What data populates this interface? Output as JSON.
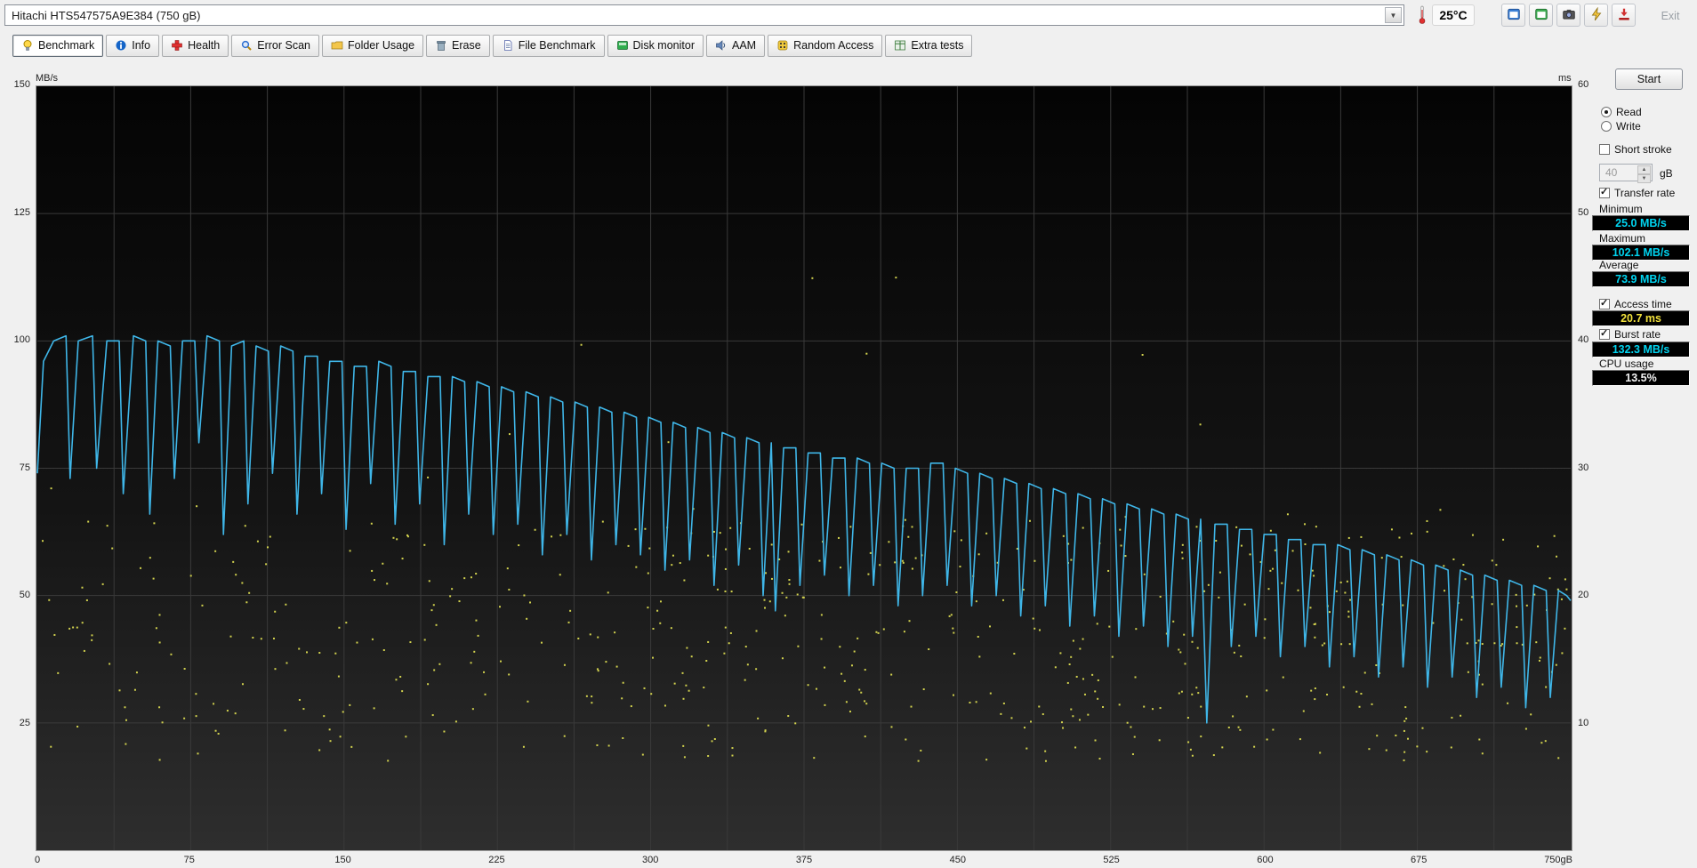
{
  "window": {
    "device_selector": "Hitachi HTS547575A9E384 (750 gB)",
    "temperature": "25°C",
    "exit_label": "Exit",
    "toolbar_buttons": [
      "window-copy-icon",
      "window-compare-icon",
      "camera-icon",
      "connect-icon",
      "download-icon"
    ]
  },
  "tabs": [
    {
      "label": "Benchmark",
      "icon": "benchmark-icon",
      "active": true
    },
    {
      "label": "Info",
      "icon": "info-icon",
      "active": false
    },
    {
      "label": "Health",
      "icon": "health-icon",
      "active": false
    },
    {
      "label": "Error Scan",
      "icon": "error-scan-icon",
      "active": false
    },
    {
      "label": "Folder Usage",
      "icon": "folder-usage-icon",
      "active": false
    },
    {
      "label": "Erase",
      "icon": "erase-icon",
      "active": false
    },
    {
      "label": "File Benchmark",
      "icon": "file-benchmark-icon",
      "active": false
    },
    {
      "label": "Disk monitor",
      "icon": "disk-monitor-icon",
      "active": false
    },
    {
      "label": "AAM",
      "icon": "aam-icon",
      "active": false
    },
    {
      "label": "Random Access",
      "icon": "random-access-icon",
      "active": false
    },
    {
      "label": "Extra tests",
      "icon": "extra-tests-icon",
      "active": false
    }
  ],
  "panel": {
    "start_button": "Start",
    "read_label": "Read",
    "read_selected": true,
    "write_label": "Write",
    "write_selected": false,
    "short_stroke_label": "Short stroke",
    "short_stroke_checked": false,
    "capacity_value": "40",
    "capacity_unit": "gB",
    "transfer_rate_label": "Transfer rate",
    "transfer_rate_checked": true,
    "minimum_label": "Minimum",
    "minimum_value": "25.0 MB/s",
    "maximum_label": "Maximum",
    "maximum_value": "102.1 MB/s",
    "average_label": "Average",
    "average_value": "73.9 MB/s",
    "access_time_label": "Access time",
    "access_time_checked": true,
    "access_time_value": "20.7 ms",
    "burst_rate_label": "Burst rate",
    "burst_rate_checked": true,
    "burst_rate_value": "132.3 MB/s",
    "cpu_usage_label": "CPU usage",
    "cpu_usage_value": "13.5%",
    "value_colors": {
      "rate": "#00d4f0",
      "access": "#f2e23c",
      "cpu": "#f2f2f2"
    }
  },
  "chart_data": {
    "type": "line+scatter",
    "left_axis": {
      "label": "MB/s",
      "min": 0,
      "max": 150,
      "ticks": [
        150,
        125,
        100,
        75,
        50,
        25
      ]
    },
    "right_axis": {
      "label": "ms",
      "min": 0,
      "max": 60,
      "ticks": [
        60,
        50,
        40,
        30,
        20,
        10
      ]
    },
    "x_axis": {
      "label": "gB",
      "min": 0,
      "max": 750,
      "ticks": [
        0,
        75,
        150,
        225,
        300,
        375,
        450,
        525,
        600,
        675
      ],
      "max_label": "750gB"
    },
    "grid": {
      "v_divisions": 20,
      "h_step": 25,
      "color": "#3a3a3a"
    },
    "plot_bg": [
      "#040404",
      "#2e2e2e"
    ],
    "series": [
      {
        "name": "Transfer rate",
        "type": "line",
        "axis": "left",
        "unit": "MB/s",
        "color": "#3fb6e8",
        "stats": {
          "minimum": 25.0,
          "maximum": 102.1,
          "average": 73.9
        },
        "points": [
          [
            0,
            74
          ],
          [
            3,
            96
          ],
          [
            8,
            100
          ],
          [
            14,
            101
          ],
          [
            16,
            73
          ],
          [
            20,
            100
          ],
          [
            27,
            101
          ],
          [
            29,
            75
          ],
          [
            34,
            100
          ],
          [
            40,
            100
          ],
          [
            42,
            70
          ],
          [
            47,
            101
          ],
          [
            53,
            100
          ],
          [
            55,
            66
          ],
          [
            59,
            100
          ],
          [
            65,
            99
          ],
          [
            67,
            73
          ],
          [
            71,
            100
          ],
          [
            77,
            100
          ],
          [
            79,
            80
          ],
          [
            83,
            101
          ],
          [
            89,
            100
          ],
          [
            91,
            62
          ],
          [
            95,
            99
          ],
          [
            101,
            100
          ],
          [
            103,
            68
          ],
          [
            107,
            99
          ],
          [
            113,
            98
          ],
          [
            115,
            74
          ],
          [
            119,
            99
          ],
          [
            125,
            98
          ],
          [
            127,
            66
          ],
          [
            131,
            97
          ],
          [
            137,
            97
          ],
          [
            139,
            70
          ],
          [
            143,
            96
          ],
          [
            149,
            96
          ],
          [
            151,
            63
          ],
          [
            155,
            95
          ],
          [
            161,
            95
          ],
          [
            163,
            72
          ],
          [
            167,
            96
          ],
          [
            173,
            95
          ],
          [
            175,
            64
          ],
          [
            179,
            94
          ],
          [
            185,
            94
          ],
          [
            187,
            68
          ],
          [
            191,
            93
          ],
          [
            197,
            93
          ],
          [
            199,
            60
          ],
          [
            203,
            93
          ],
          [
            209,
            92
          ],
          [
            211,
            66
          ],
          [
            215,
            92
          ],
          [
            221,
            91
          ],
          [
            223,
            62
          ],
          [
            227,
            91
          ],
          [
            233,
            90
          ],
          [
            235,
            64
          ],
          [
            239,
            90
          ],
          [
            245,
            89
          ],
          [
            247,
            58
          ],
          [
            251,
            89
          ],
          [
            257,
            88
          ],
          [
            259,
            62
          ],
          [
            263,
            88
          ],
          [
            269,
            87
          ],
          [
            271,
            57
          ],
          [
            275,
            87
          ],
          [
            281,
            86
          ],
          [
            283,
            60
          ],
          [
            287,
            86
          ],
          [
            293,
            85
          ],
          [
            295,
            58
          ],
          [
            299,
            85
          ],
          [
            305,
            84
          ],
          [
            307,
            55
          ],
          [
            311,
            84
          ],
          [
            317,
            83
          ],
          [
            319,
            57
          ],
          [
            323,
            83
          ],
          [
            329,
            82
          ],
          [
            331,
            52
          ],
          [
            335,
            82
          ],
          [
            341,
            81
          ],
          [
            343,
            56
          ],
          [
            347,
            81
          ],
          [
            353,
            80
          ],
          [
            355,
            50
          ],
          [
            359,
            80
          ],
          [
            361,
            47
          ],
          [
            365,
            79
          ],
          [
            371,
            79
          ],
          [
            373,
            52
          ],
          [
            377,
            78
          ],
          [
            383,
            78
          ],
          [
            385,
            54
          ],
          [
            389,
            77
          ],
          [
            395,
            77
          ],
          [
            397,
            50
          ],
          [
            401,
            77
          ],
          [
            407,
            76
          ],
          [
            409,
            52
          ],
          [
            413,
            76
          ],
          [
            419,
            75
          ],
          [
            421,
            48
          ],
          [
            425,
            75
          ],
          [
            431,
            75
          ],
          [
            433,
            50
          ],
          [
            437,
            76
          ],
          [
            443,
            76
          ],
          [
            445,
            52
          ],
          [
            449,
            75
          ],
          [
            455,
            74
          ],
          [
            457,
            48
          ],
          [
            461,
            74
          ],
          [
            467,
            73
          ],
          [
            469,
            50
          ],
          [
            473,
            73
          ],
          [
            479,
            72
          ],
          [
            481,
            46
          ],
          [
            485,
            72
          ],
          [
            491,
            71
          ],
          [
            493,
            48
          ],
          [
            497,
            71
          ],
          [
            503,
            70
          ],
          [
            505,
            44
          ],
          [
            509,
            70
          ],
          [
            515,
            69
          ],
          [
            517,
            46
          ],
          [
            521,
            69
          ],
          [
            527,
            68
          ],
          [
            529,
            42
          ],
          [
            533,
            68
          ],
          [
            539,
            67
          ],
          [
            541,
            44
          ],
          [
            545,
            67
          ],
          [
            551,
            66
          ],
          [
            553,
            40
          ],
          [
            557,
            66
          ],
          [
            563,
            65
          ],
          [
            565,
            42
          ],
          [
            569,
            65
          ],
          [
            572,
            25
          ],
          [
            576,
            64
          ],
          [
            582,
            64
          ],
          [
            584,
            40
          ],
          [
            588,
            63
          ],
          [
            594,
            63
          ],
          [
            596,
            42
          ],
          [
            600,
            62
          ],
          [
            606,
            62
          ],
          [
            608,
            38
          ],
          [
            612,
            61
          ],
          [
            618,
            61
          ],
          [
            620,
            40
          ],
          [
            624,
            60
          ],
          [
            630,
            60
          ],
          [
            632,
            36
          ],
          [
            636,
            60
          ],
          [
            642,
            59
          ],
          [
            644,
            38
          ],
          [
            648,
            59
          ],
          [
            654,
            58
          ],
          [
            656,
            34
          ],
          [
            660,
            58
          ],
          [
            666,
            57
          ],
          [
            668,
            36
          ],
          [
            672,
            57
          ],
          [
            678,
            56
          ],
          [
            680,
            32
          ],
          [
            684,
            56
          ],
          [
            690,
            55
          ],
          [
            692,
            34
          ],
          [
            696,
            55
          ],
          [
            702,
            54
          ],
          [
            704,
            30
          ],
          [
            708,
            54
          ],
          [
            714,
            53
          ],
          [
            716,
            32
          ],
          [
            720,
            53
          ],
          [
            726,
            52
          ],
          [
            728,
            28
          ],
          [
            732,
            52
          ],
          [
            738,
            51
          ],
          [
            740,
            30
          ],
          [
            744,
            51
          ],
          [
            748,
            50
          ],
          [
            750,
            49
          ]
        ]
      },
      {
        "name": "Access time",
        "type": "scatter",
        "axis": "right",
        "unit": "ms",
        "color": "#d2d24e",
        "stats": {
          "average_ms": 20.7
        },
        "generator": {
          "seed": 1337,
          "count": 600,
          "x_max": 748,
          "ms_base": 7,
          "ms_spread": 19,
          "outlier_fraction": 0.06,
          "outlier_extra_ms": 24,
          "x_bias_exponent": 0.8
        }
      }
    ]
  }
}
